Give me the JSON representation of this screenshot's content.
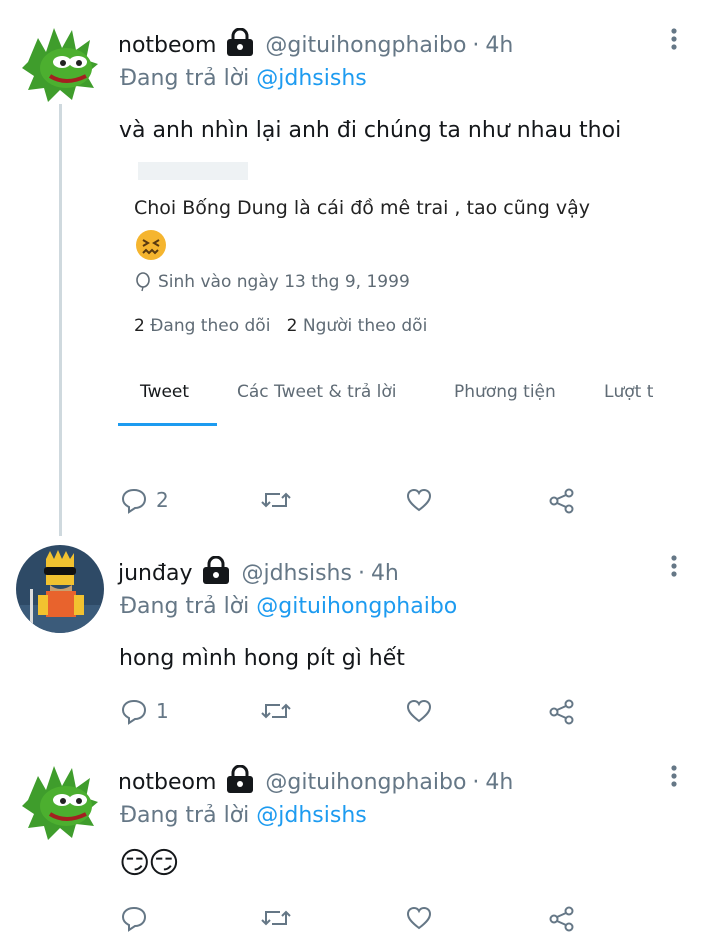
{
  "tweets": [
    {
      "name": "notbeom",
      "handle": "@gituihongphaibo",
      "dot": "·",
      "time": "4h",
      "reply_prefix": "Đang trả lời",
      "reply_mention": "@jdhsishs",
      "text": "và anh nhìn lại anh đi chúng ta như nhau thoi",
      "reply_count": "2"
    },
    {
      "name": "junđay",
      "handle": "@jdhsishs",
      "dot": "·",
      "time": "4h",
      "reply_prefix": "Đang trả lời",
      "reply_mention": "@gituihongphaibo",
      "text": "hong mình hong pít gì hết",
      "reply_count": "1"
    },
    {
      "name": "notbeom",
      "handle": "@gituihongphaibo",
      "dot": "·",
      "time": "4h",
      "reply_prefix": "Đang trả lời",
      "reply_mention": "@jdhsishs",
      "text": "😏😏",
      "reply_count": ""
    }
  ],
  "embedded_profile": {
    "bio": "Choi Bống Dung là cái đồ mê trai ,  tao cũng vậy",
    "bio_emoji": "😖",
    "birthday": "Sinh vào ngày 13 thg 9, 1999",
    "following_count": "2",
    "following_label": "Đang theo dõi",
    "followers_count": "2",
    "followers_label": "Người theo dõi",
    "tabs": [
      "Tweet",
      "Các Tweet & trả lời",
      "Phương tiện",
      "Lượt t"
    ]
  },
  "icons": {
    "lock": "lock-icon",
    "more": "more-vertical-icon",
    "reply": "reply-icon",
    "retweet": "retweet-icon",
    "like": "heart-icon",
    "share": "share-icon",
    "birthday": "balloon-icon"
  },
  "colors": {
    "accent": "#1d9bf0",
    "secondary_text": "#657786",
    "thread_line": "#cfd9de"
  }
}
